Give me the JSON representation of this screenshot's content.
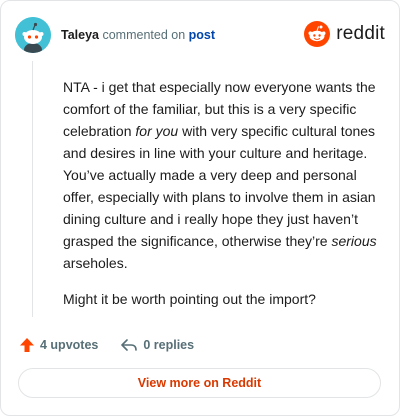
{
  "header": {
    "username": "Taleya",
    "action_text": "commented on",
    "post_link": "post",
    "brand_name": "reddit"
  },
  "comment": {
    "p1": {
      "part1": "NTA - i get that especially now everyone wants the comfort of the familiar, but this is a very specific celebration ",
      "emph1": "for you",
      "part2": " with very specific cultural tones and desires in line with your culture and heritage. You’ve actually made a very deep and personal offer, especially with plans to involve them in asian dining culture and i really hope they just haven’t grasped the significance, otherwise they’re ",
      "emph2": "serious",
      "part3": " arseholes."
    },
    "p2": "Might it be worth pointing out the import?"
  },
  "actions": {
    "upvotes_label": "4 upvotes",
    "replies_label": "0 replies"
  },
  "cta": {
    "view_more_label": "View more on Reddit"
  },
  "colors": {
    "accent": "#d93900",
    "reddit_orange": "#ff4500",
    "link_blue": "#0045ac",
    "avatar_bg": "#42c1d6"
  },
  "icons": {
    "upvote": "upvote-arrow-icon",
    "reply": "reply-arrow-icon",
    "brand": "reddit-logo-icon"
  }
}
